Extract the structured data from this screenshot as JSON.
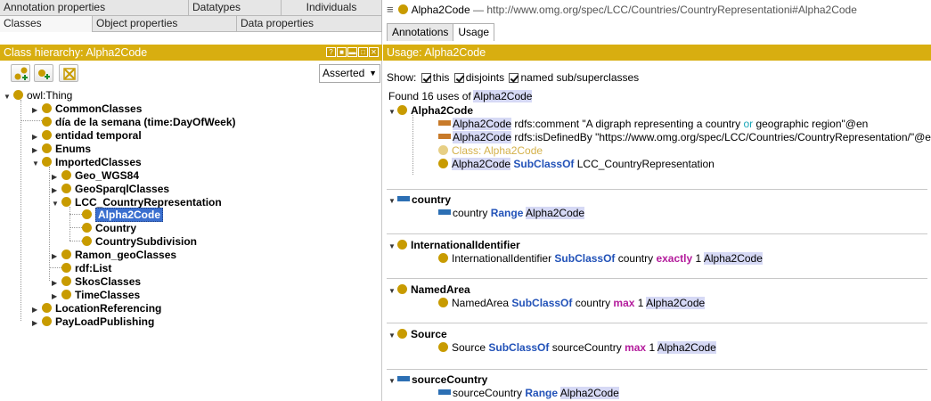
{
  "left": {
    "tabs_row1": [
      "Annotation properties",
      "Datatypes",
      "Individuals"
    ],
    "tabs_row2": [
      "Classes",
      "Object properties",
      "Data properties"
    ],
    "hierarchy_title": "Class hierarchy: Alpha2Code",
    "window_buttons": [
      "?",
      "■",
      "▬",
      "□",
      "✕"
    ],
    "toolbar": {
      "add_subclass_icon": "add-subclass-icon",
      "add_sibling_icon": "add-sibling-icon",
      "delete_icon": "delete-class-icon"
    },
    "asserted": "Asserted",
    "tree": [
      {
        "label": "owl:Thing",
        "plain": true
      },
      {
        "label": "CommonClasses"
      },
      {
        "label": "día de la semana (time:DayOfWeek)"
      },
      {
        "label": "entidad temporal"
      },
      {
        "label": "Enums"
      },
      {
        "label": "ImportedClasses"
      },
      {
        "label": "Geo_WGS84"
      },
      {
        "label": "GeoSparqlClasses"
      },
      {
        "label": "LCC_CountryRepresentation"
      },
      {
        "label": "Alpha2Code",
        "selected": true
      },
      {
        "label": "Country"
      },
      {
        "label": "CountrySubdivision"
      },
      {
        "label": "Ramon_geoClasses"
      },
      {
        "label": "rdf:List"
      },
      {
        "label": "SkosClasses"
      },
      {
        "label": "TimeClasses"
      },
      {
        "label": "LocationReferencing"
      },
      {
        "label": "PayLoadPublishing"
      }
    ]
  },
  "right": {
    "title_name": "Alpha2Code",
    "title_sep": "—",
    "title_iri": "http://www.omg.org/spec/LCC/Countries/CountryRepresentationi#Alpha2Code",
    "tabs": [
      "Annotations",
      "Usage"
    ],
    "usage_title": "Usage: Alpha2Code",
    "show_label": "Show:",
    "show_options": [
      "this",
      "disjoints",
      "named sub/superclasses"
    ],
    "found_prefix": "Found 16 uses of",
    "found_name": "Alpha2Code",
    "groups": {
      "alpha": {
        "head": "Alpha2Code",
        "l1_a": "Alpha2Code",
        "l1_b": " rdfs:comment \"A digraph representing a country ",
        "l1_or": "or",
        "l1_c": " geographic region\"@en",
        "l2_a": "Alpha2Code",
        "l2_b": " rdfs:isDefinedBy \"https://www.omg.org/spec/LCC/Countries/CountryRepresentation/\"@en",
        "l3_a": "Class:",
        "l3_b": " Alpha2Code",
        "l4_a": "Alpha2Code",
        "l4_kw": " SubClassOf",
        "l4_b": " LCC_CountryRepresentation"
      },
      "country": {
        "head": "country",
        "l1_a": "country ",
        "l1_kw": "Range",
        "l1_b": "Alpha2Code"
      },
      "intl": {
        "head": "InternationalIdentifier",
        "l1_a": "InternationalIdentifier ",
        "l1_kw": "SubClassOf",
        "l1_b": " country ",
        "l1_kw2": "exactly",
        "l1_num": " 1 ",
        "l1_c": "Alpha2Code"
      },
      "named": {
        "head": "NamedArea",
        "l1_a": "NamedArea ",
        "l1_kw": "SubClassOf",
        "l1_b": " country ",
        "l1_kw2": "max",
        "l1_num": " 1 ",
        "l1_c": "Alpha2Code"
      },
      "source": {
        "head": "Source",
        "l1_a": "Source ",
        "l1_kw": "SubClassOf",
        "l1_b": " sourceCountry ",
        "l1_kw2": "max",
        "l1_num": " 1 ",
        "l1_c": "Alpha2Code"
      },
      "sourceCountry": {
        "head": "sourceCountry",
        "l1_a": "sourceCountry ",
        "l1_kw": "Range",
        "l1_b": "Alpha2Code"
      }
    }
  },
  "colors": {
    "accent": "#d8ae10",
    "class_dot": "#c89b00",
    "property_blue": "#2c6fb4",
    "annotation_orange": "#c87a2a",
    "selection": "#3a6fcf"
  }
}
